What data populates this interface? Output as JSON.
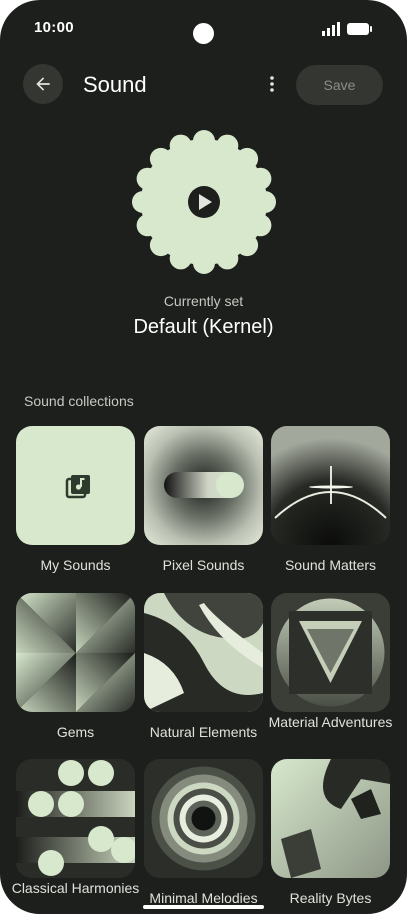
{
  "status_bar": {
    "time": "10:00",
    "icons": [
      "signal-icon",
      "battery-icon"
    ]
  },
  "app_bar": {
    "title": "Sound",
    "save_label": "Save",
    "back_icon": "arrow-back-icon",
    "more_icon": "more-vert-icon"
  },
  "current": {
    "label": "Currently set",
    "name": "Default (Kernel)"
  },
  "section": {
    "title": "Sound collections"
  },
  "collections": [
    {
      "label": "My Sounds",
      "icon": "music-library-icon"
    },
    {
      "label": "Pixel Sounds"
    },
    {
      "label": "Sound Matters"
    },
    {
      "label": "Gems"
    },
    {
      "label": "Natural Elements"
    },
    {
      "label": "Material Adventures"
    },
    {
      "label": "Classical Harmonies"
    },
    {
      "label": "Minimal Melodies"
    },
    {
      "label": "Reality Bytes"
    }
  ],
  "colors": {
    "background": "#1d1f1c",
    "accent": "#d7e8cd",
    "surface": "#333631",
    "text": "#ffffff"
  }
}
